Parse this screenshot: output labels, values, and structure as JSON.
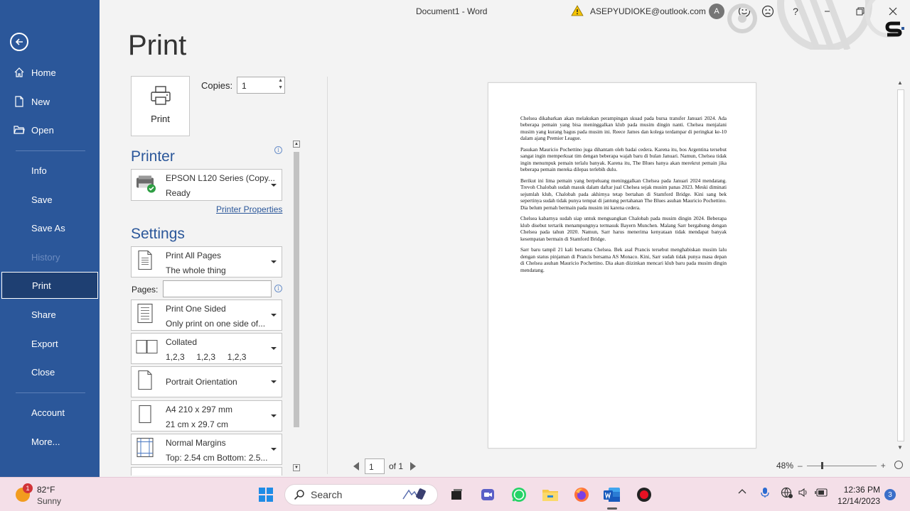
{
  "titlebar": {
    "document_title": "Document1  -  Word",
    "account_email": "ASEPYUDIOKE@outlook.com",
    "avatar_initial": "A",
    "help": "?"
  },
  "sidebar": {
    "items": [
      {
        "label": "Home",
        "icon": "home-icon"
      },
      {
        "label": "New",
        "icon": "new-document-icon"
      },
      {
        "label": "Open",
        "icon": "folder-open-icon"
      },
      {
        "label": "Info"
      },
      {
        "label": "Save"
      },
      {
        "label": "Save As"
      },
      {
        "label": "History",
        "disabled": true
      },
      {
        "label": "Print",
        "active": true
      },
      {
        "label": "Share"
      },
      {
        "label": "Export"
      },
      {
        "label": "Close"
      },
      {
        "label": "Account"
      },
      {
        "label": "More..."
      }
    ]
  },
  "print_panel": {
    "title": "Print",
    "print_button_label": "Print",
    "copies_label": "Copies:",
    "copies_value": "1",
    "printer_heading": "Printer",
    "printer": {
      "name": "EPSON L120 Series (Copy...",
      "status": "Ready"
    },
    "printer_properties_link": "Printer Properties",
    "settings_heading": "Settings",
    "pages_label": "Pages:",
    "pages_value": "",
    "settings": [
      {
        "line1": "Print All Pages",
        "line2": "The whole thing"
      },
      {
        "line1": "Print One Sided",
        "line2": "Only print on one side of..."
      },
      {
        "line1": "Collated",
        "line2": "1,2,3     1,2,3     1,2,3"
      },
      {
        "line1": "Portrait Orientation"
      },
      {
        "line1": "A4 210 x 297 mm",
        "line2": "21 cm x 29.7 cm"
      },
      {
        "line1": "Normal Margins",
        "line2": "Top: 2.54 cm Bottom: 2.5..."
      }
    ]
  },
  "preview": {
    "paragraphs": [
      "Chelsea dikabarkan akan melakukan perampingan skuad pada bursa transfer Januari 2024. Ada beberapa pemain yang bisa meninggalkan klub pada musim dingin nanti. Chelsea menjalani musim yang kurang bagus pada musim ini. Reece James dan kolega terdampar di peringkat ke-10 dalam ajang Premier League.",
      "Pasukan Mauricio Pochettino juga dihantam oleh badai cedera. Karena itu, bos Argentina tersebut sangat ingin memperkuat tim dengan beberapa wajah baru di bulan Januari. Namun, Chelsea tidak ingin menumpuk pemain terlalu banyak. Karena itu, The Blues hanya akan merekrut pemain jika beberapa pemain mereka dilepas terlebih dulu.",
      "Berikut ini lima pemain yang berpeluang meninggalkan Chelsea pada Januari 2024 mendatang. Trevoh Chalobah sudah masuk dalam daftar jual Chelsea sejak musim panas 2023. Meski diminati sejumlah klub, Chalobah pada akhirnya tetap bertahan di Stamford Bridge. Kini sang bek sepertinya sudah tidak punya tempat di jantung pertahanan The Blues asuhan Mauricio Pochettino. Dia belum pernah bermain pada musim ini karena cedera.",
      "Chelsea kabarnya sudah siap untuk menguangkan Chalobah pada musim dingin 2024. Beberapa klub disebut tertarik menampungnya termasuk Bayern Munchen. Malang Sarr bergabung dengan Chelsea pada tahun 2020. Namun, Sarr harus menerima kenyataan tidak mendapat banyak kesempatan bermain di Stamford Bridge.",
      "Sarr baru tampil 21 kali bersama Chelsea. Bek asal Prancis tersebut menghabiskan musim lalu dengan status pinjaman di Prancis bersama AS Monaco. Kini, Sarr sudah tidak punya masa depan di Chelsea asuhan Mauricio Pochettino. Dia akan diizinkan mencari klub baru pada musim dingin mendatang."
    ],
    "current_page": "1",
    "of_pages": "of 1",
    "zoom": "48%",
    "zoom_minus": "–",
    "zoom_plus": "+"
  },
  "taskbar": {
    "weather_badge": "1",
    "temperature": "82°F",
    "condition": "Sunny",
    "search_label": "Search",
    "time": "12:36 PM",
    "date": "12/14/2023",
    "notification_count": "3"
  },
  "colors": {
    "sidebar_bg": "#2b579a",
    "sidebar_active": "#1e3f72",
    "accent": "#2b579a",
    "taskbar_bg": "#f4dfe8"
  }
}
